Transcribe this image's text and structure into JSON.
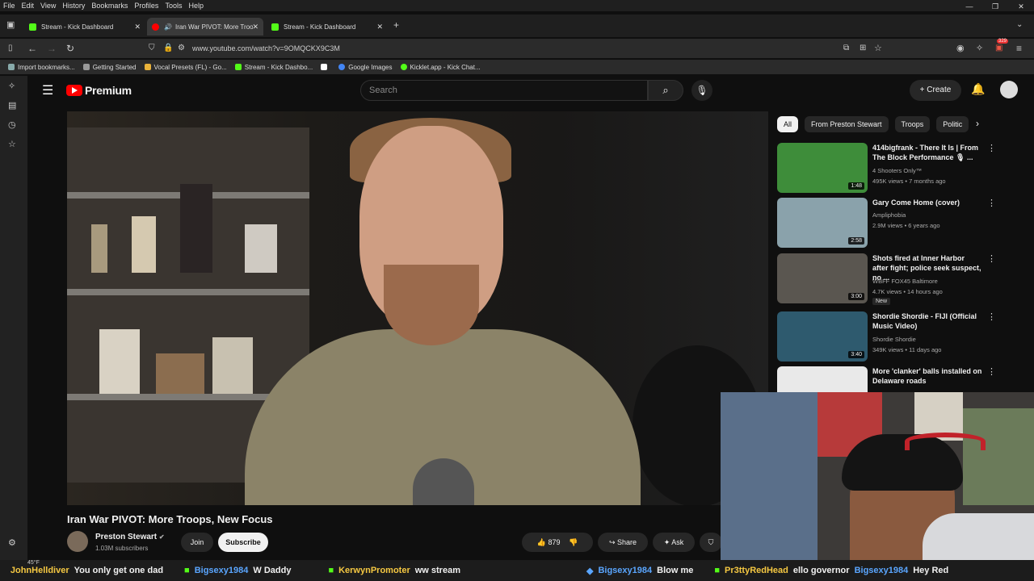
{
  "browser": {
    "menu": [
      "File",
      "Edit",
      "View",
      "History",
      "Bookmarks",
      "Profiles",
      "Tools",
      "Help"
    ],
    "tabs": [
      {
        "label": "Stream - Kick Dashboard",
        "color": "#53fc18"
      },
      {
        "label": "Iran War PIVOT: More Troo",
        "color": "#ff0000"
      },
      {
        "label": "Stream - Kick Dashboard",
        "color": "#53fc18"
      }
    ],
    "url": "www.youtube.com/watch?v=9OMQCKX9C3M",
    "ext_badge": "329",
    "bookmarks": [
      "Import bookmarks...",
      "Getting Started",
      "Vocal Presets (FL) - Go...",
      "Stream - Kick Dashbo...",
      "Google Images",
      "Kicklet.app - Kick Chat..."
    ]
  },
  "youtube": {
    "logo_text": "Premium",
    "search_placeholder": "Search",
    "create_label": "Create",
    "video_title": "Iran War PIVOT: More Troops, New Focus",
    "channel_name": "Preston Stewart",
    "subscribers": "1.03M subscribers",
    "join_label": "Join",
    "subscribe_label": "Subscribe",
    "likes": "879",
    "share_label": "Share",
    "ask_label": "Ask",
    "chips": [
      "All",
      "From Preston Stewart",
      "Troops",
      "Politic"
    ],
    "recommendations": [
      {
        "title": "414bigfrank - There It Is | From The Block Performance 🎙 ...",
        "channel": "4 Shooters Only™",
        "meta": "495K views • 7 months ago",
        "duration": "1:48",
        "thumb": "#3e8d3a"
      },
      {
        "title": "Gary Come Home (cover)",
        "channel": "Ampliphobia",
        "meta": "2.9M views • 6 years ago",
        "duration": "2:58",
        "thumb": "#8aa2ab"
      },
      {
        "title": "Shots fired at Inner Harbor after fight; police seek suspect, no ...",
        "channel": "WBFF FOX45 Baltimore",
        "meta": "4.7K views • 14 hours ago",
        "duration": "3:00",
        "thumb": "#5a5650",
        "badge": "New"
      },
      {
        "title": "Shordie Shordie - FIJI (Official Music Video)",
        "channel": "Shordie Shordie",
        "meta": "349K views • 11 days ago",
        "duration": "3:40",
        "thumb": "#2e5a6e"
      },
      {
        "title": "More 'clanker' balls installed on Delaware roads",
        "channel": "",
        "meta": "",
        "duration": "",
        "thumb": "#e9e9e9"
      }
    ]
  },
  "ticker": {
    "weather": "45°F",
    "items": [
      {
        "user": "JohnHelldiver",
        "msg": "You only get one dad"
      },
      {
        "user": "Bigsexy1984",
        "msg": "W Daddy"
      },
      {
        "user": "KerwynPromoter",
        "msg": "ww stream"
      },
      {
        "user": "Bigsexy1984",
        "msg": "Blow me"
      },
      {
        "user": "Pr3ttyRedHead",
        "msg": "ello governor"
      },
      {
        "user": "Bigsexy1984",
        "msg": "Hey Red"
      }
    ]
  }
}
